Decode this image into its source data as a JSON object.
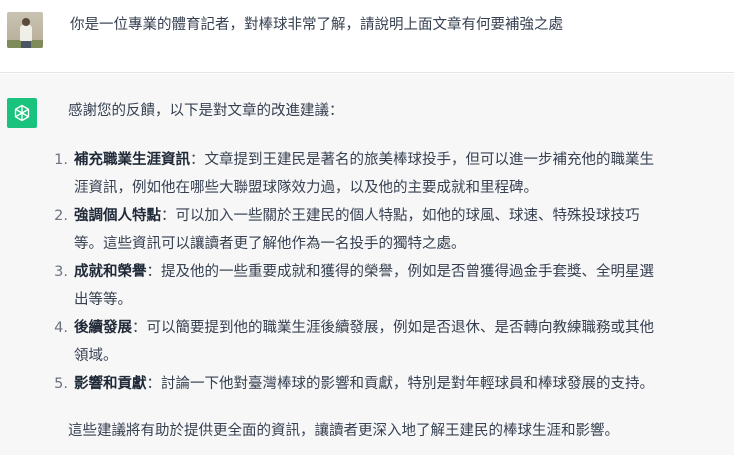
{
  "user_message": {
    "text": "你是一位專業的體育記者，對棒球非常了解，請說明上面文章有何要補強之處"
  },
  "assistant_message": {
    "intro": "感謝您的反饋，以下是對文章的改進建議：",
    "items": [
      {
        "number": "1.",
        "title": "補充職業生涯資訊",
        "line1": "：文章提到王建民是著名的旅美棒球投手，但可以進一步補充他的職業生",
        "line2": "涯資訊，例如他在哪些大聯盟球隊效力過，以及他的主要成就和里程碑。"
      },
      {
        "number": "2.",
        "title": "強調個人特點",
        "line1": "：可以加入一些關於王建民的個人特點，如他的球風、球速、特殊投球技巧",
        "line2": "等。這些資訊可以讓讀者更了解他作為一名投手的獨特之處。"
      },
      {
        "number": "3.",
        "title": "成就和榮譽",
        "line1": "：提及他的一些重要成就和獲得的榮譽，例如是否曾獲得過金手套獎、全明星選",
        "line2": "出等等。"
      },
      {
        "number": "4.",
        "title": "後續發展",
        "line1": "：可以簡要提到他的職業生涯後續發展，例如是否退休、是否轉向教練職務或其他",
        "line2": "領域。"
      },
      {
        "number": "5.",
        "title": "影響和貢獻",
        "line1": "：討論一下他對臺灣棒球的影響和貢獻，特別是對年輕球員和棒球發展的支持。",
        "line2": ""
      }
    ],
    "outro": "這些建議將有助於提供更全面的資訊，讓讀者更深入地了解王建民的棒球生涯和影響。"
  },
  "colors": {
    "assistant_bg": "#f7f7f8",
    "bot_avatar": "#19c37d",
    "text": "#374151"
  },
  "icons": {
    "user_avatar": "user-photo-avatar",
    "bot_avatar": "openai-logo-icon"
  }
}
